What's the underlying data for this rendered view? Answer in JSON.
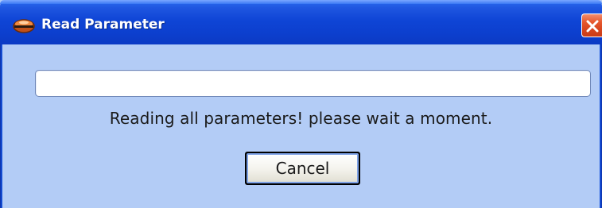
{
  "window": {
    "title": "Read Parameter",
    "icon": "app-icon",
    "close_icon": "close-icon"
  },
  "progress": {
    "value_percent": 0
  },
  "message": "Reading all parameters! please wait a moment.",
  "buttons": {
    "cancel_label": "Cancel"
  },
  "colors": {
    "titlebar": "#0c3fce",
    "client_background": "#b3ccf6",
    "close_button": "#d6441e"
  }
}
